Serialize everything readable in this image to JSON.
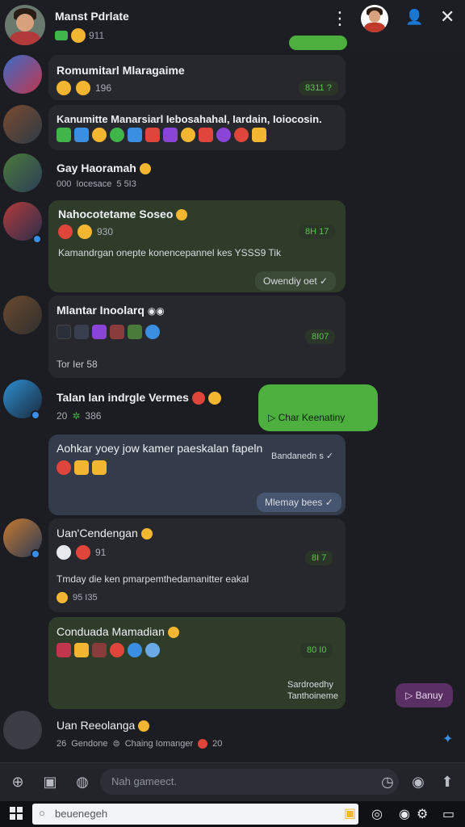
{
  "header": {
    "title": "Manst Pdrlate",
    "sub_count": "911"
  },
  "chats": [
    {
      "name": "Romumitarl Mlaragaime",
      "meta_num": "196",
      "time": "8311 ?"
    },
    {
      "name": "Kanumitte Manarsiarl Iebosahahal, Iardain, Ioiocosin.",
      "time": ""
    },
    {
      "name": "Gay Haoramah",
      "meta_a": "000",
      "meta_b": "Iocesace",
      "meta_c": "5 5I3"
    },
    {
      "name": "Nahocotetame Soseo",
      "meta_num": "930",
      "time": "8H 17",
      "text": "Kamandrgan onepte konencepannel kes YSSS9 Tik",
      "status": "Owendiy oet ✓"
    },
    {
      "name": "Mlantar Inoolarq",
      "time": "8I07",
      "text": "Tor Ier 58"
    },
    {
      "name": "Talan lan indrgle Vermes",
      "meta_a": "20",
      "meta_b": "386",
      "green_btn": "Char Keenatiny"
    },
    {
      "name": "Aohkar yoey jow kamer paeskalan fapeln",
      "right_text": "Bandanedn s ✓",
      "status": "Mlemay bees ✓"
    },
    {
      "name": "Uan'Cendengan",
      "meta_num": "91",
      "time": "8I 7",
      "text": "Tmday die ken pmarpemthedamanitter eakal",
      "meta_b": "95 I35"
    },
    {
      "name": "Conduada Mamadian",
      "time": "80 I0",
      "right1": "Sardroedhy",
      "right2": "Tanthoineme"
    },
    {
      "name": "Uan Reeolanga",
      "meta": "Gendone",
      "meta_b": "Chaing Iomanger",
      "meta_c": "20"
    }
  ],
  "side_pill": "Banuy",
  "composer": {
    "placeholder": "Nah gameect."
  },
  "taskbar": {
    "search": "beuenegeh"
  }
}
